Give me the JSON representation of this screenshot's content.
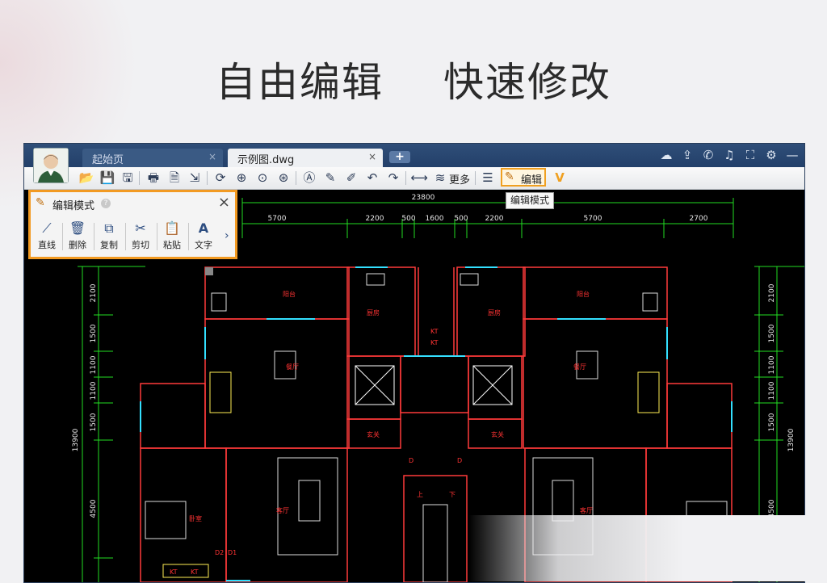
{
  "headline": {
    "left": "自由编辑",
    "right": "快速修改"
  },
  "tabs": [
    {
      "label": "起始页",
      "close": "×"
    },
    {
      "label": "示例图.dwg",
      "close": "×"
    }
  ],
  "tab_add": "+",
  "toolbar": {
    "more_label": "更多",
    "edit_mode_label": "编辑",
    "tooltip": "编辑模式"
  },
  "edit_panel": {
    "title": "编辑模式",
    "help": "?",
    "close": "×",
    "tools": [
      {
        "label": "直线",
        "icon": "line-icon"
      },
      {
        "label": "删除",
        "icon": "trash-icon"
      },
      {
        "label": "复制",
        "icon": "copy-icon"
      },
      {
        "label": "剪切",
        "icon": "scissors-icon"
      },
      {
        "label": "粘贴",
        "icon": "paste-icon"
      },
      {
        "label": "文字",
        "icon": "text-icon"
      }
    ]
  },
  "drawing": {
    "total_width": "23800",
    "top_dims": [
      "5700",
      "2200",
      "500",
      "1600",
      "500",
      "2200",
      "5700",
      "2700"
    ],
    "left_dims": [
      "2100",
      "1500",
      "1100",
      "1100",
      "1500",
      "4500"
    ],
    "right_dims": [
      "2100",
      "1500",
      "1100",
      "1100",
      "1500",
      "4500"
    ],
    "total_height": "13900",
    "rooms": [
      "阳台",
      "厨房",
      "厨房",
      "阳台",
      "餐厅",
      "餐厅",
      "玄关",
      "玄关",
      "卧室",
      "客厅",
      "客厅"
    ],
    "ac_labels": [
      "KT",
      "KT",
      "KT",
      "KT"
    ],
    "door_labels": [
      "D",
      "D",
      "D2",
      "D1"
    ],
    "stair_labels": [
      "上",
      "下"
    ]
  }
}
